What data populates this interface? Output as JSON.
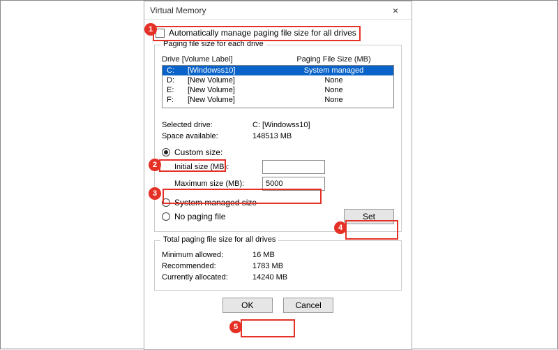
{
  "dialog": {
    "title": "Virtual Memory",
    "close_symbol": "×"
  },
  "auto_manage": {
    "label": "Automatically manage paging file size for all drives",
    "checked": false
  },
  "drives_group": {
    "title": "Paging file size for each drive",
    "header_drive": "Drive  [Volume Label]",
    "header_size": "Paging File Size (MB)",
    "rows": [
      {
        "letter": "C:",
        "label": "[Windowss10]",
        "size": "System managed",
        "selected": true
      },
      {
        "letter": "D:",
        "label": "[New Volume]",
        "size": "None",
        "selected": false
      },
      {
        "letter": "E:",
        "label": "[New Volume]",
        "size": "None",
        "selected": false
      },
      {
        "letter": "F:",
        "label": "[New Volume]",
        "size": "None",
        "selected": false
      }
    ],
    "selected_drive_label": "Selected drive:",
    "selected_drive_value": "C:  [Windowss10]",
    "space_available_label": "Space available:",
    "space_available_value": "148513 MB"
  },
  "size_options": {
    "custom_label": "Custom size:",
    "initial_label": "Initial size (MB):",
    "initial_value": "",
    "maximum_label": "Maximum size (MB):",
    "maximum_value": "5000",
    "system_managed_label": "System managed size",
    "no_paging_label": "No paging file",
    "set_label": "Set"
  },
  "totals_group": {
    "title": "Total paging file size for all drives",
    "min_label": "Minimum allowed:",
    "min_value": "16 MB",
    "rec_label": "Recommended:",
    "rec_value": "1783 MB",
    "cur_label": "Currently allocated:",
    "cur_value": "14240 MB"
  },
  "buttons": {
    "ok": "OK",
    "cancel": "Cancel"
  },
  "annotations": {
    "step1": "1",
    "step2": "2",
    "step3": "3",
    "step4": "4",
    "step5": "5"
  }
}
